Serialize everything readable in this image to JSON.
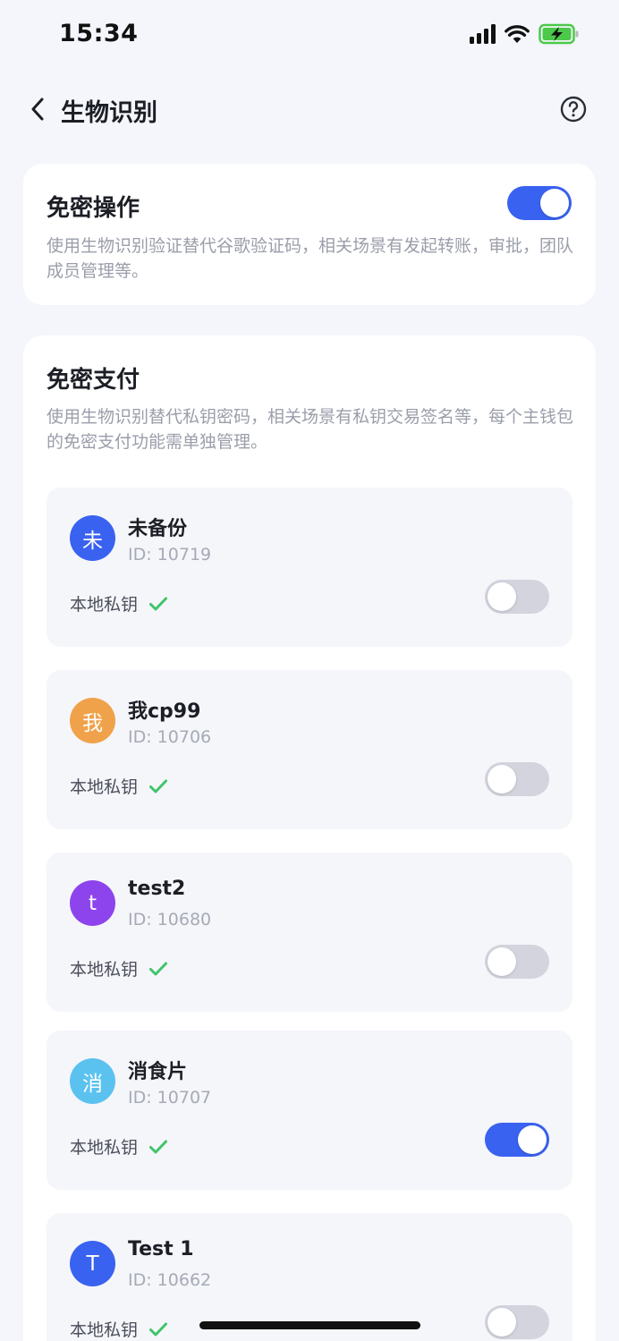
{
  "status_bar": {
    "time": "15:34"
  },
  "nav": {
    "title": "生物识别"
  },
  "password_free_operation": {
    "title": "免密操作",
    "description": "使用生物识别验证替代谷歌验证码，相关场景有发起转账，审批，团队成员管理等。",
    "enabled": true
  },
  "password_free_payment": {
    "title": "免密支付",
    "description": "使用生物识别替代私钥密码，相关场景有私钥交易签名等，每个主钱包的免密支付功能需单独管理。",
    "wallets": [
      {
        "avatar_text": "未",
        "avatar_color": "#3A62F0",
        "name": "未备份",
        "id": "ID: 10719",
        "key_label": "本地私钥",
        "enabled": false
      },
      {
        "avatar_text": "我",
        "avatar_color": "#F0A24A",
        "name": "我cp99",
        "id": "ID: 10706",
        "key_label": "本地私钥",
        "enabled": false
      },
      {
        "avatar_text": "t",
        "avatar_color": "#8E44EC",
        "name": "test2",
        "id": "ID: 10680",
        "key_label": "本地私钥",
        "enabled": false
      },
      {
        "avatar_text": "消",
        "avatar_color": "#5BC2F0",
        "name": "消食片",
        "id": "ID: 10707",
        "key_label": "本地私钥",
        "enabled": true
      },
      {
        "avatar_text": "T",
        "avatar_color": "#3A62F0",
        "name": "Test 1",
        "id": "ID: 10662",
        "key_label": "本地私钥",
        "enabled": false
      }
    ]
  },
  "colors": {
    "accent": "#3A62F0",
    "check": "#3FC46B",
    "background": "#F4F6FB"
  },
  "icons": {
    "back": "chevron-left-icon",
    "help": "question-circle-icon",
    "check": "check-icon"
  }
}
